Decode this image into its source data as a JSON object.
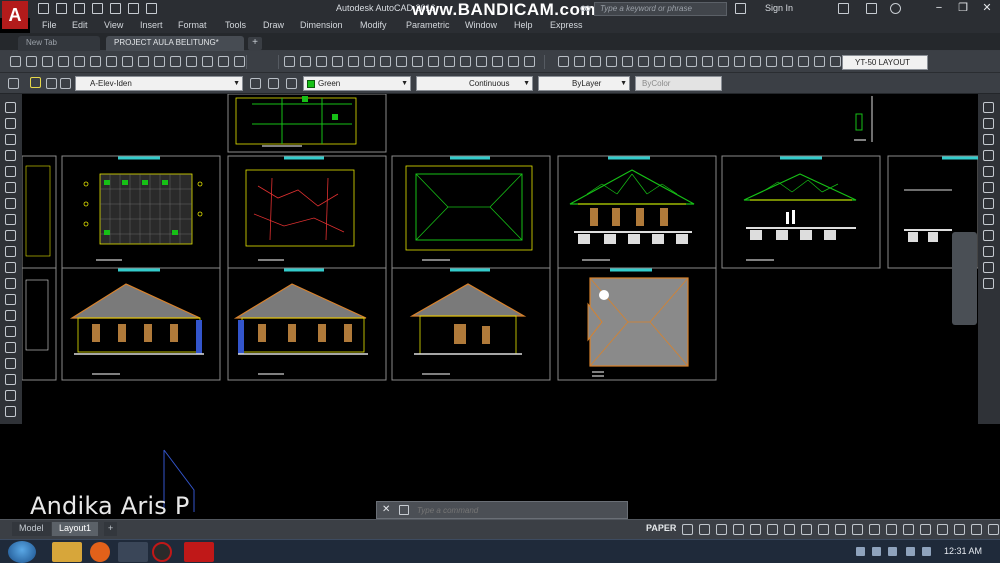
{
  "window": {
    "app_logo": "A",
    "title": "Autodesk AutoCAD 2016",
    "overlay_watermark": "www.BANDICAM.com",
    "search_placeholder": "Type a keyword or phrase",
    "signin_label": "Sign In",
    "controls": [
      "−",
      "❐",
      "✕"
    ]
  },
  "menu": [
    "File",
    "Edit",
    "View",
    "Insert",
    "Format",
    "Tools",
    "Draw",
    "Dimension",
    "Modify",
    "Parametric",
    "Window",
    "Help",
    "Express"
  ],
  "tabs": [
    {
      "label": "New Tab",
      "active": false
    },
    {
      "label": "PROJECT AULA BELITUNG*",
      "active": true
    }
  ],
  "tab_plus": "+",
  "layout_selector": "YT-50 LAYOUT",
  "properties": {
    "layer": "A-Elev-Iden",
    "color": "Green",
    "linetype": "Continuous",
    "lineweight": "ByLayer",
    "plotstyle": "ByColor"
  },
  "command_line": {
    "close": "✕",
    "placeholder": "Type a command"
  },
  "model_tabs": [
    {
      "label": "Model",
      "active": false
    },
    {
      "label": "Layout1",
      "active": true
    }
  ],
  "model_tab_add": "+",
  "status": {
    "space": "PAPER"
  },
  "taskbar": {
    "clock": "12:31 AM"
  },
  "overlay_author": "Andika Aris P",
  "colors": {
    "accent_red": "#b31b1b",
    "cad_green": "#16c016",
    "cad_yellow": "#e6e600",
    "cad_orange": "#d9822b",
    "cad_cyan": "#33cccc"
  }
}
